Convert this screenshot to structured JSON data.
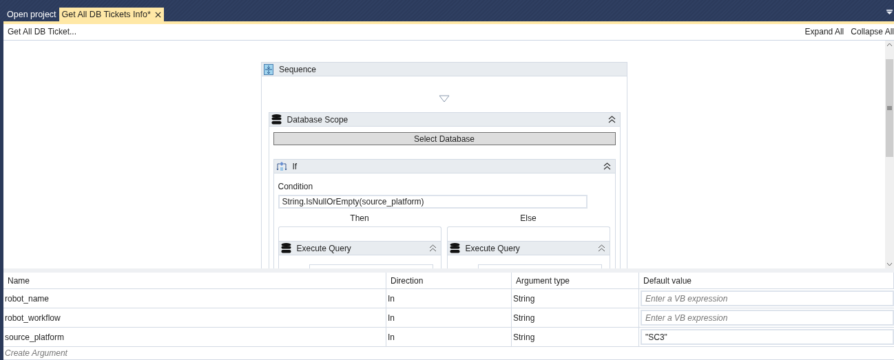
{
  "tabs": [
    {
      "label": "Open project",
      "selected": false,
      "closable": false
    },
    {
      "label": "Get All DB Tickets Info*",
      "selected": true,
      "closable": true
    }
  ],
  "breadcrumb": "Get All DB Ticket...",
  "toolbar_links": [
    "Expand All",
    "Collapse All"
  ],
  "designer": {
    "sequence": {
      "title": "Sequence"
    },
    "database_scope": {
      "title": "Database Scope",
      "button": "Select Database"
    },
    "if": {
      "title": "If",
      "condition_label": "Condition",
      "condition": "String.IsNullOrEmpty(source_platform)",
      "branches": [
        {
          "label": "Then",
          "activity": "Execute Query"
        },
        {
          "label": "Else",
          "activity": "Execute Query"
        }
      ]
    }
  },
  "arguments": {
    "columns": [
      "Name",
      "Direction",
      "Argument type",
      "Default value"
    ],
    "rows": [
      {
        "name": "robot_name",
        "direction": "In",
        "type": "String",
        "default_value": {
          "placeholder": "Enter a VB expression"
        }
      },
      {
        "name": "robot_workflow",
        "direction": "In",
        "type": "String",
        "default_value": {
          "placeholder": "Enter a VB expression"
        }
      },
      {
        "name": "source_platform",
        "direction": "In",
        "type": "String",
        "default_value": {
          "value": "\"SC3\""
        }
      }
    ],
    "create_label": "Create Argument"
  }
}
